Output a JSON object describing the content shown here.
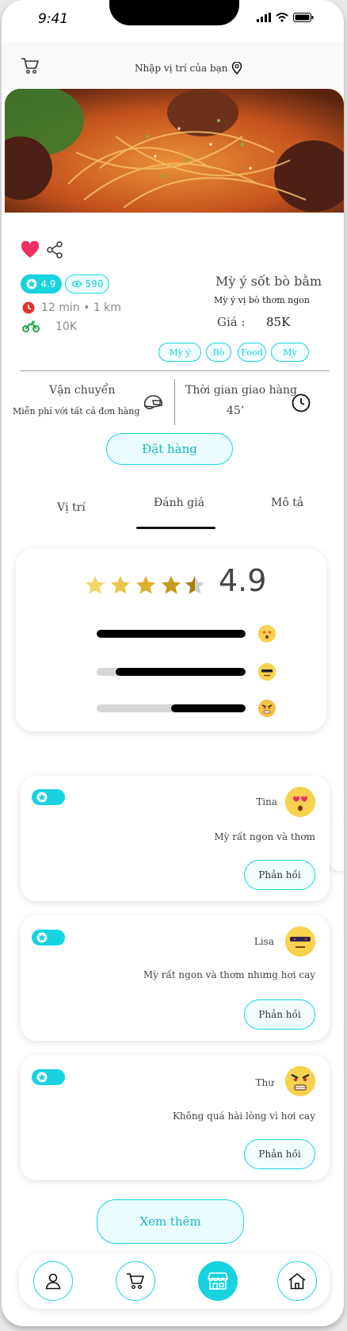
{
  "status": {
    "time": "9:41"
  },
  "header": {
    "location_placeholder": "Nhập vị trí của bạn"
  },
  "product": {
    "rating": "4.9",
    "views": "590",
    "time_distance": "12 min • 1 km",
    "delivery_fee": "10K",
    "name": "Mỳ ý sốt bò bằm",
    "subtitle": "Mỳ ý vị bò thơm ngon",
    "price_label": "Giá :",
    "price": "85K",
    "tags": [
      "Mỳ ý",
      "Bò",
      "Food",
      "Mỳ"
    ]
  },
  "shipping": {
    "title": "Vận chuyển",
    "description": "Miễn phí  với tất cả đơn hàng",
    "time_title": "Thời gian giao hàng",
    "time_value": "45’"
  },
  "order_button": "Đặt hàng",
  "tabs": [
    "Vị trí",
    "Đánh giá",
    "Mô tả"
  ],
  "active_tab": 1,
  "rating_summary": {
    "score": "4.9",
    "stars": 4.5,
    "bars": [
      {
        "fraction": 1.0,
        "emoji": "blush-face-icon"
      },
      {
        "fraction": 0.87,
        "emoji": "cool-face-icon"
      },
      {
        "fraction": 0.5,
        "emoji": "angry-face-icon"
      }
    ]
  },
  "reviews": [
    {
      "name": "Tina",
      "text": "Mỳ rất ngon và thơm",
      "reply": "Phản hồi",
      "avatar": "heart-eyes-face-icon"
    },
    {
      "name": "Lisa",
      "text": "Mỳ rất ngon và thơm nhưng hơi cay",
      "reply": "Phản hồi",
      "avatar": "sunglasses-face-icon"
    },
    {
      "name": "Thư",
      "text": "Không quá hài lòng  vì hơi cay",
      "reply": "Phản hồi",
      "avatar": "angry-face-icon"
    }
  ],
  "more_button": "Xem thêm",
  "nav": {
    "items": [
      "user-icon",
      "cart-icon",
      "store-icon",
      "home-icon"
    ],
    "active": 2
  },
  "colors": {
    "accent": "#17d3e0",
    "heart": "#f2305f",
    "clock": "#e0332e",
    "bike": "#1aa84a"
  }
}
